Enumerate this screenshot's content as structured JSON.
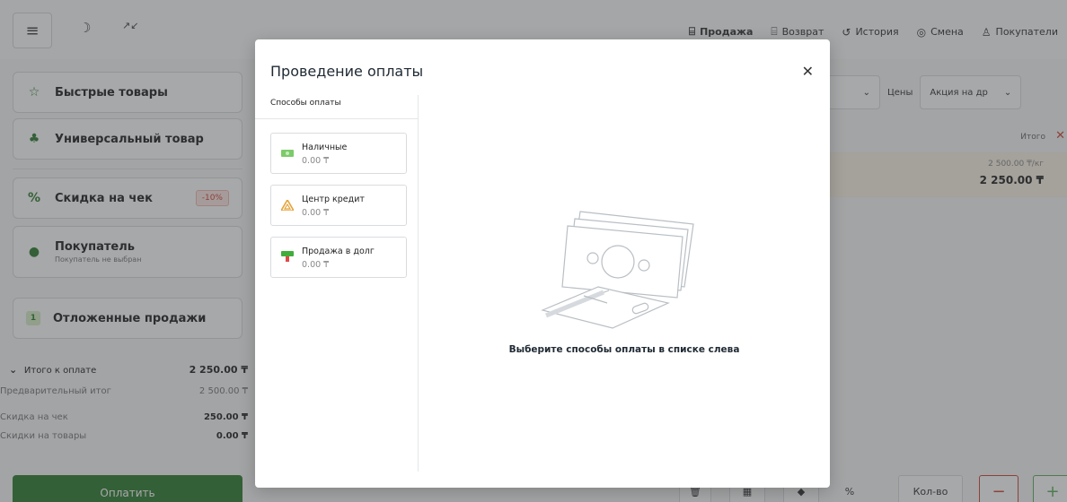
{
  "nav": {
    "items": [
      {
        "label": "Продажа",
        "icon": "trash-bag-icon",
        "active": true
      },
      {
        "label": "Возврат",
        "icon": "return-icon",
        "active": false
      },
      {
        "label": "История",
        "icon": "history-icon",
        "active": false
      },
      {
        "label": "Смена",
        "icon": "shift-icon",
        "active": false
      },
      {
        "label": "Покупатели",
        "icon": "user-icon",
        "active": false
      }
    ]
  },
  "left": {
    "quick_goods": "Быстрые товары",
    "universal_goods": "Универсальный товар",
    "check_discount": "Скидка на чек",
    "check_discount_badge": "-10%",
    "customer": "Покупатель",
    "customer_sub": "Покупатель не выбран",
    "deferred_count": "1",
    "deferred_sales": "Отложенные продажи"
  },
  "totals": {
    "to_pay_label": "Итого к оплате",
    "to_pay_value": "2 250.00 ₸",
    "pre_total_label": "Предварительный итог",
    "pre_total_value": "2 500.00 ₸",
    "check_discount_label": "Скидка на чек",
    "check_discount_value": "250.00 ₸",
    "goods_discount_label": "Скидки на товары",
    "goods_discount_value": "0.00 ₸",
    "pay_button": "Оплатить"
  },
  "right": {
    "prices_label": "Цены",
    "prices_value": "Акция на др",
    "itogo": "Итого",
    "row_price": "2 500.00 ₸/кг",
    "row_total": "2 250.00 ₸",
    "qty_button": "Кол-во"
  },
  "modal": {
    "title": "Проведение оплаты",
    "methods_header": "Способы оплаты",
    "methods": [
      {
        "name": "Наличные",
        "amount": "0.00 ₸",
        "icon": "cash-icon",
        "color": "#7ccb6a"
      },
      {
        "name": "Центр кредит",
        "amount": "0.00 ₸",
        "icon": "bank-triangle-icon",
        "color": "#e5a33a"
      },
      {
        "name": "Продажа в долг",
        "amount": "0.00 ₸",
        "icon": "debt-icon",
        "color": "#3fae3b"
      }
    ],
    "empty_message": "Выберите способы оплаты в списке слева"
  }
}
